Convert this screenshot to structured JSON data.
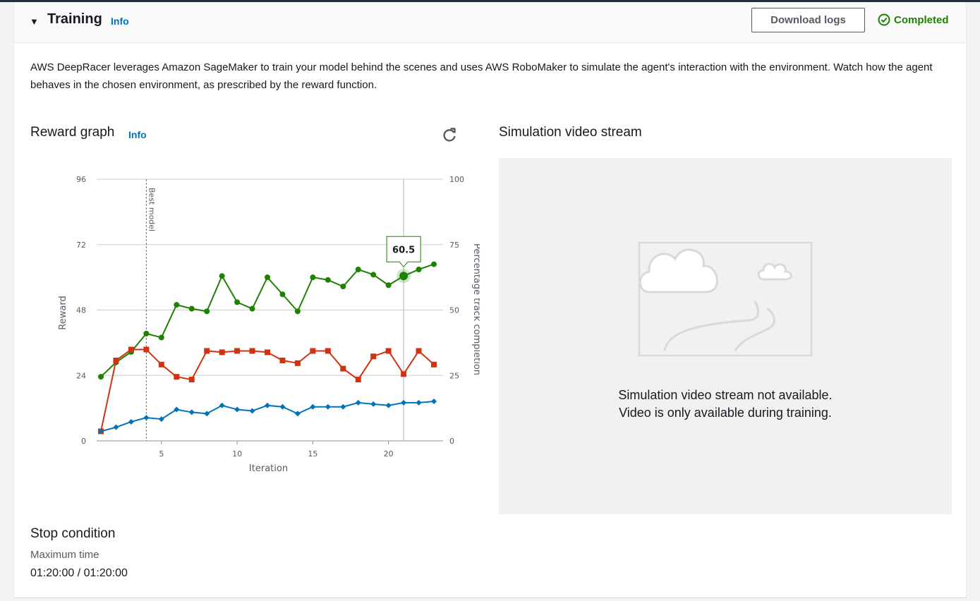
{
  "section": {
    "title": "Training",
    "info_label": "Info",
    "download_label": "Download logs",
    "status_label": "Completed"
  },
  "description": "AWS DeepRacer leverages Amazon SageMaker to train your model behind the scenes and uses AWS RoboMaker to simulate the agent's interaction with the environment. Watch how the agent behaves in the chosen environment, as prescribed by the reward function.",
  "reward_graph": {
    "title": "Reward graph",
    "info_label": "Info",
    "best_model_label": "Best model",
    "tooltip_value": "60.5"
  },
  "simulation": {
    "title": "Simulation video stream",
    "message_line1": "Simulation video stream not available.",
    "message_line2": "Video is only available during training."
  },
  "stop_condition": {
    "title": "Stop condition",
    "label": "Maximum time",
    "value": "01:20:00 / 01:20:00"
  },
  "colors": {
    "green": "#1d8102",
    "red": "#d13212",
    "blue": "#0073bb",
    "link": "#0073bb"
  },
  "chart_data": {
    "type": "line",
    "xlabel": "Iteration",
    "ylabel": "Reward",
    "y2label": "Percentage track completion",
    "xlim": [
      1,
      23
    ],
    "ylim": [
      0,
      96
    ],
    "y2lim": [
      0,
      100
    ],
    "xticks": [
      5,
      10,
      15,
      20
    ],
    "yticks": [
      0,
      24,
      48,
      72,
      96
    ],
    "y2ticks": [
      0,
      25,
      50,
      75,
      100
    ],
    "best_model_iteration": 4,
    "hover_iteration": 21,
    "x": [
      1,
      2,
      3,
      4,
      5,
      6,
      7,
      8,
      9,
      10,
      11,
      12,
      13,
      14,
      15,
      16,
      17,
      18,
      19,
      20,
      21,
      22,
      23
    ],
    "series": [
      {
        "color": "#1d8102",
        "marker": "circle",
        "axis": "y2",
        "values": [
          24.5,
          30,
          34,
          41,
          39.5,
          52,
          50.5,
          49.5,
          63,
          53,
          50.5,
          62.5,
          56,
          49.5,
          62.5,
          61.5,
          59,
          65.5,
          63.5,
          59.5,
          63,
          65.5,
          67.5
        ]
      },
      {
        "color": "#d13212",
        "marker": "square",
        "axis": "y",
        "values": [
          3.5,
          29.5,
          33.5,
          33.5,
          28,
          23.5,
          22.5,
          33,
          32.5,
          33,
          33,
          32.5,
          29.5,
          28.5,
          33,
          33,
          26.5,
          22.5,
          31,
          33,
          24.5,
          33,
          28
        ]
      },
      {
        "color": "#0073bb",
        "marker": "diamond",
        "axis": "y",
        "values": [
          3.5,
          5,
          7,
          8.5,
          8,
          11.5,
          10.5,
          10,
          13,
          11.5,
          11,
          13,
          12.5,
          10,
          12.5,
          12.5,
          12.5,
          14,
          13.5,
          13,
          14,
          14,
          14.5
        ]
      }
    ]
  }
}
